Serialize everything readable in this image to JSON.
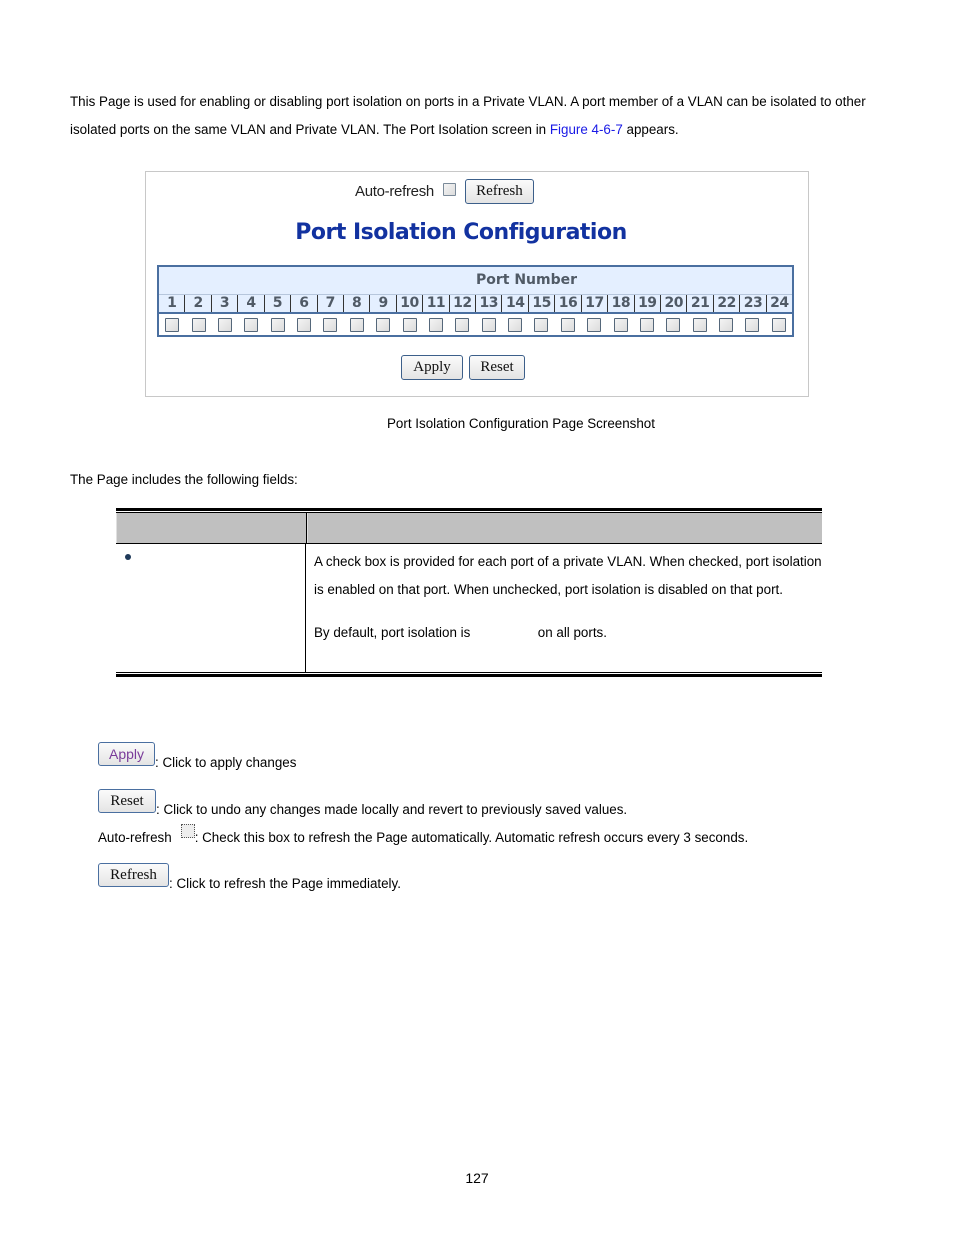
{
  "intro": {
    "text_before_link": "This Page is used for enabling or disabling port isolation on ports in a Private VLAN. A port member of a VLAN can be isolated to other isolated ports on the same VLAN and Private VLAN. The Port Isolation screen in ",
    "link": "Figure 4-6-7",
    "text_after_link": " appears."
  },
  "screenshot": {
    "auto_refresh_label": "Auto-refresh",
    "auto_refresh_checked": false,
    "refresh_button": "Refresh",
    "title": "Port Isolation Configuration",
    "port_header": "Port Number",
    "ports": [
      "1",
      "2",
      "3",
      "4",
      "5",
      "6",
      "7",
      "8",
      "9",
      "10",
      "11",
      "12",
      "13",
      "14",
      "15",
      "16",
      "17",
      "18",
      "19",
      "20",
      "21",
      "22",
      "23",
      "24"
    ],
    "port_checked": [
      false,
      false,
      false,
      false,
      false,
      false,
      false,
      false,
      false,
      false,
      false,
      false,
      false,
      false,
      false,
      false,
      false,
      false,
      false,
      false,
      false,
      false,
      false,
      false
    ],
    "apply_button": "Apply",
    "reset_button": "Reset"
  },
  "caption": "Port Isolation Configuration Page Screenshot",
  "fields_intro": "The Page includes the following fields:",
  "fields_table": {
    "header": [
      "",
      ""
    ],
    "rows": [
      {
        "object": "",
        "description_p1": "A check box is provided for each port of a private VLAN. When checked, port isolation is enabled on that port. When unchecked, port isolation is disabled on that port.",
        "description_p2_before": "By default, port isolation is ",
        "description_p2_after": " on all ports."
      }
    ]
  },
  "legend": {
    "apply_button": "Apply",
    "apply_text": ": Click to apply changes",
    "reset_button": "Reset",
    "reset_text": ": Click to undo any changes made locally and revert to previously saved values.",
    "auto_label": "Auto-refresh",
    "auto_text": ": Check this box to refresh the Page automatically. Automatic refresh occurs every 3 seconds.",
    "refresh_button": "Refresh",
    "refresh_text": ": Click to refresh the Page immediately."
  },
  "page_number": "127"
}
